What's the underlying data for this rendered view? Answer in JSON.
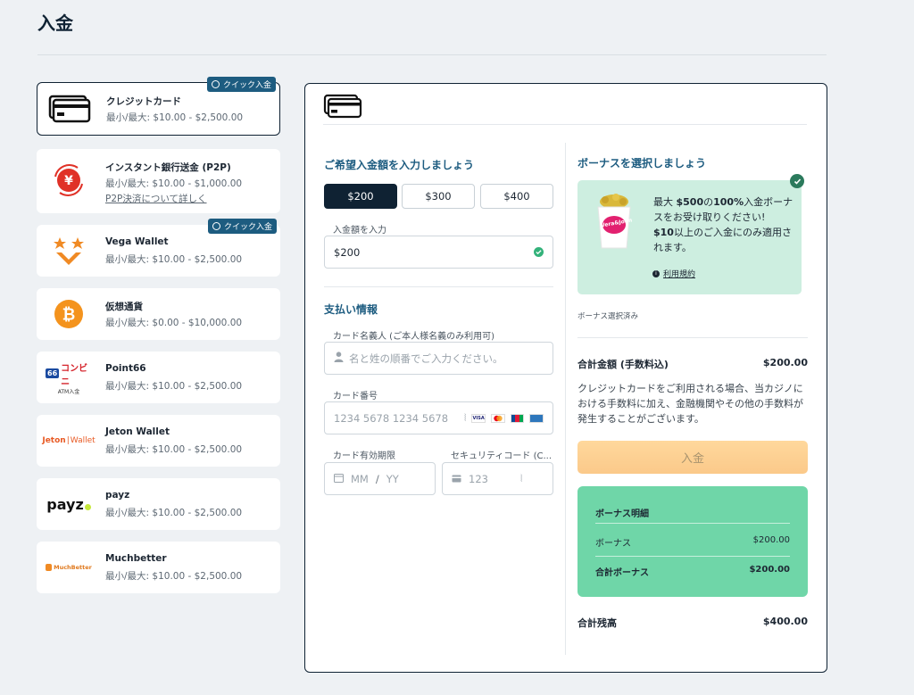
{
  "page": {
    "title": "入金"
  },
  "methods": [
    {
      "name": "クレジットカード",
      "limits": "最小/最大: $10.00 - $2,500.00",
      "quick_badge": "クイック入金",
      "logo": "credit-card-icon"
    },
    {
      "name": "インスタント銀行送金 (P2P)",
      "limits": "最小/最大: $10.00 - $1,000.00",
      "link": "P2P決済について詳しく",
      "logo": "yen-transfer-icon"
    },
    {
      "name": "Vega Wallet",
      "limits": "最小/最大: $10.00 - $2,500.00",
      "quick_badge": "クイック入金",
      "logo": "vega-wallet-logo"
    },
    {
      "name": "仮想通貨",
      "limits": "最小/最大: $0.00 - $10,000.00",
      "logo": "bitcoin-icon"
    },
    {
      "name": "Point66",
      "limits": "最小/最大: $10.00 - $2,500.00",
      "logo": "point66-logo",
      "logo_text": "コンビニ",
      "logo_sub": "ATM入金",
      "logo_num": "66"
    },
    {
      "name": "Jeton Wallet",
      "limits": "最小/最大: $10.00 - $2,500.00",
      "logo": "jeton-logo",
      "logo_text_a": "Jeton",
      "logo_text_b": "Wallet"
    },
    {
      "name": "payz",
      "limits": "最小/最大: $10.00 - $2,500.00",
      "logo": "payz-logo",
      "logo_text": "payz"
    },
    {
      "name": "Muchbetter",
      "limits": "最小/最大: $10.00 - $2,500.00",
      "logo": "muchbetter-logo",
      "logo_text": "MuchBetter"
    }
  ],
  "deposit": {
    "heading": "ご希望入金額を入力しましょう",
    "presets": [
      "$200",
      "$300",
      "$400"
    ],
    "selected_preset": "$200",
    "amount_label": "入金額を入力",
    "amount_value": "$200"
  },
  "payment_info": {
    "heading": "支払い情報",
    "cardholder_label": "カード名義人 (ご本人様名義のみ利用可)",
    "cardholder_placeholder": "名と姓の順番でご入力ください。",
    "card_number_label": "カード番号",
    "card_number_placeholder": "1234 5678 1234 5678",
    "expiry_label": "カード有効期限",
    "expiry_month_placeholder": "MM",
    "expiry_separator": "/",
    "expiry_year_placeholder": "YY",
    "cvc_label": "セキュリティコード (C...",
    "cvc_placeholder": "123",
    "card_brands": [
      "VISA",
      "Mastercard",
      "JCB",
      "Amex"
    ]
  },
  "bonus": {
    "heading": "ボーナスを選択しましょう",
    "text_prefix": "最大 ",
    "text_amount": "$500",
    "text_mid": "の",
    "text_pct": "100%",
    "text_rest": "入金ボーナスをお受け取りください!",
    "text_min": "$10",
    "text_tail": "以上のご入金にのみ適用されます。",
    "terms_link": "利用規約",
    "selected_note": "ボーナス選択済み",
    "logo_text": "Vera&John"
  },
  "summary": {
    "total_label": "合計金額 (手数料込)",
    "total_value": "$200.00",
    "fee_note": "クレジットカードをご利用される場合、当カジノにおける手数料に加え、金融機関やその他の手数料が発生することがございます。",
    "deposit_button": "入金",
    "bonus_detail_title": "ボーナス明細",
    "bonus_label": "ボーナス",
    "bonus_value": "$200.00",
    "total_bonus_label": "合計ボーナス",
    "total_bonus_value": "$200.00",
    "balance_label": "合計残高",
    "balance_value": "$400.00"
  },
  "colors": {
    "accent": "#1d5c80",
    "dark": "#0f2233",
    "bonus_bg": "#cdeee0",
    "detail_bg": "#6fd6a8",
    "deposit_btn": "#fbc98a"
  }
}
